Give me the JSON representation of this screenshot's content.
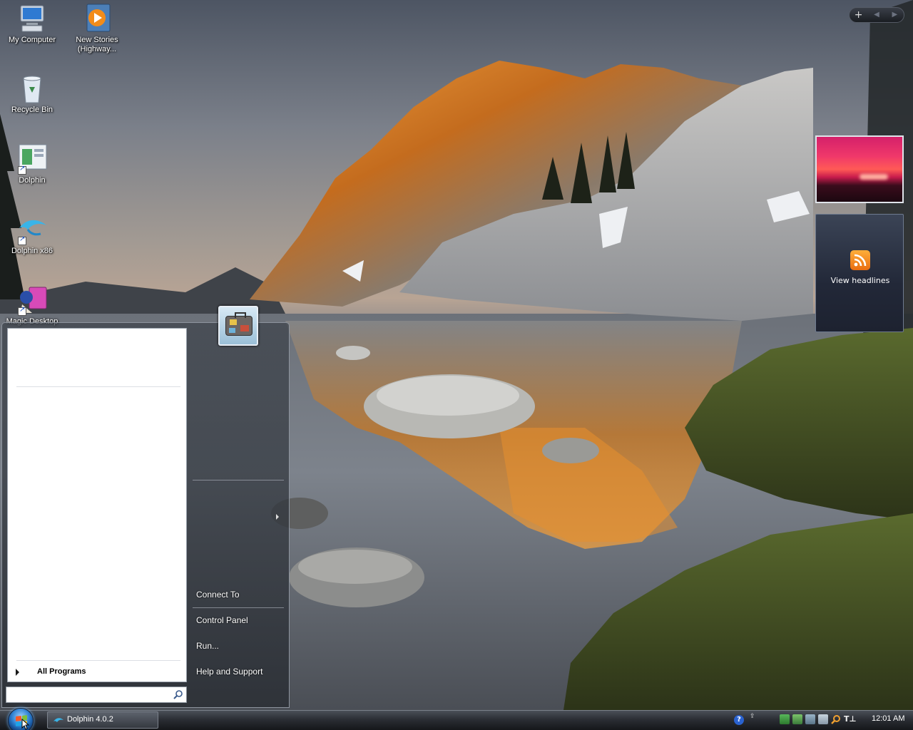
{
  "desktop": {
    "icons": [
      {
        "label": "My Computer",
        "icon": "computer-icon"
      },
      {
        "label": "New Stories\n(Highway...",
        "icon": "media-file-icon"
      },
      {
        "label": "Recycle Bin",
        "icon": "recycle-bin-icon"
      },
      {
        "label": "Dolphin",
        "icon": "dolphin-shortcut-icon"
      },
      {
        "label": "Dolphin x86",
        "icon": "dolphin-x86-shortcut-icon"
      },
      {
        "label": "Magic Desktop",
        "icon": "magic-desktop-shortcut-icon"
      }
    ]
  },
  "sidebar": {
    "add_button": "+",
    "prev_button": "◀",
    "next_button": "▶",
    "feed_gadget_label": "View headlines"
  },
  "start_menu": {
    "all_programs": "All Programs",
    "search_placeholder": "",
    "right_items": [
      "Connect To",
      "Control Panel",
      "Run...",
      "Help and Support"
    ]
  },
  "taskbar": {
    "task_label": "Dolphin 4.0.2",
    "clock": "12:01 AM",
    "tray_icons": [
      "help-icon",
      "network-icon",
      "safety-icon",
      "monitor-icon",
      "device-icon",
      "volume-icon",
      "search-icon",
      "language-icon"
    ]
  },
  "colors": {
    "accent": "#2c7fd1",
    "feed_orange": "#f08a24"
  }
}
